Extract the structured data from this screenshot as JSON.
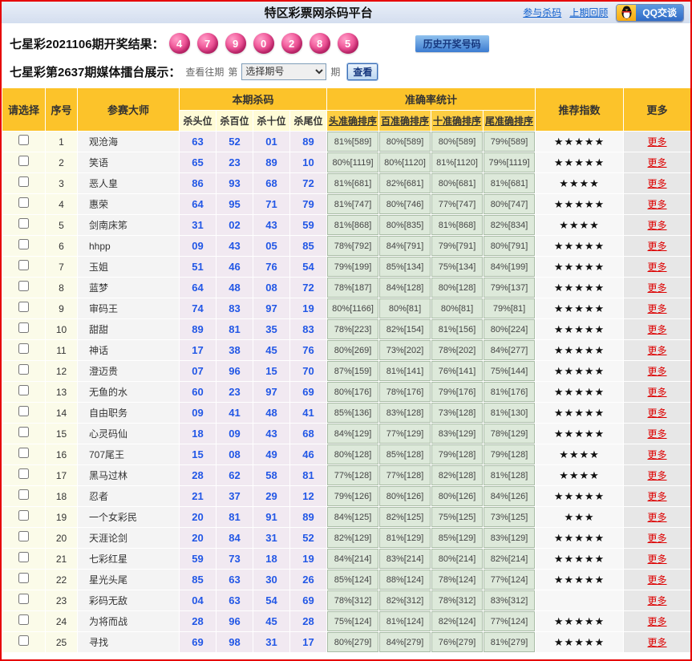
{
  "colors": {
    "page_border": "#E60000",
    "header_gold": "#FCC32A",
    "ball_pink": "#D93880",
    "kill_number_blue": "#2257E6",
    "stat_green_bg": "#DDE9DA",
    "more_red": "#DD0000",
    "link_blue": "#0B5CCC"
  },
  "topbar": {
    "title": "特区彩票网杀码平台",
    "link_join": "参与杀码",
    "link_prev": "上期回顾",
    "qq_label": "QQ交谈"
  },
  "draw": {
    "label": "七星彩2021106期开奖结果：",
    "balls": [
      "4",
      "7",
      "9",
      "0",
      "2",
      "8",
      "5"
    ],
    "history_button": "历史开奖号码"
  },
  "arena": {
    "label": "七星彩第2637期媒体擂台展示：",
    "view_past": "查看往期",
    "di": "第",
    "select_value": "选择期号",
    "qi": "期",
    "view_button": "查看"
  },
  "table": {
    "headers": {
      "select": "请选择",
      "no": "序号",
      "master": "参赛大师",
      "kills_group": "本期杀码",
      "stats_group": "准确率统计",
      "stars": "推荐指数",
      "more": "更多",
      "kill_cols": [
        "杀头位",
        "杀百位",
        "杀十位",
        "杀尾位"
      ],
      "stat_cols": [
        "头准确排序",
        "百准确排序",
        "十准确排序",
        "尾准确排序"
      ]
    },
    "rows": [
      {
        "no": "1",
        "name": "观沧海",
        "kills": [
          "63",
          "52",
          "01",
          "89"
        ],
        "stats": [
          "81%[589]",
          "80%[589]",
          "80%[589]",
          "79%[589]"
        ],
        "stars": 5
      },
      {
        "no": "2",
        "name": "笑语",
        "kills": [
          "65",
          "23",
          "89",
          "10"
        ],
        "stats": [
          "80%[1119]",
          "80%[1120]",
          "81%[1120]",
          "79%[1119]"
        ],
        "stars": 5
      },
      {
        "no": "3",
        "name": "恶人皇",
        "kills": [
          "86",
          "93",
          "68",
          "72"
        ],
        "stats": [
          "81%[681]",
          "82%[681]",
          "80%[681]",
          "81%[681]"
        ],
        "stars": 4
      },
      {
        "no": "4",
        "name": "惠荣",
        "kills": [
          "64",
          "95",
          "71",
          "79"
        ],
        "stats": [
          "81%[747]",
          "80%[746]",
          "77%[747]",
          "80%[747]"
        ],
        "stars": 5
      },
      {
        "no": "5",
        "name": "剑南床笫",
        "kills": [
          "31",
          "02",
          "43",
          "59"
        ],
        "stats": [
          "81%[868]",
          "80%[835]",
          "81%[868]",
          "82%[834]"
        ],
        "stars": 4
      },
      {
        "no": "6",
        "name": "hhpp",
        "kills": [
          "09",
          "43",
          "05",
          "85"
        ],
        "stats": [
          "78%[792]",
          "84%[791]",
          "79%[791]",
          "80%[791]"
        ],
        "stars": 5
      },
      {
        "no": "7",
        "name": "玉姐",
        "kills": [
          "51",
          "46",
          "76",
          "54"
        ],
        "stats": [
          "79%[199]",
          "85%[134]",
          "75%[134]",
          "84%[199]"
        ],
        "stars": 5
      },
      {
        "no": "8",
        "name": "蓝梦",
        "kills": [
          "64",
          "48",
          "08",
          "72"
        ],
        "stats": [
          "78%[187]",
          "84%[128]",
          "80%[128]",
          "79%[137]"
        ],
        "stars": 5
      },
      {
        "no": "9",
        "name": "审码王",
        "kills": [
          "74",
          "83",
          "97",
          "19"
        ],
        "stats": [
          "80%[1166]",
          "80%[81]",
          "80%[81]",
          "79%[81]"
        ],
        "stars": 5
      },
      {
        "no": "10",
        "name": "甜甜",
        "kills": [
          "89",
          "81",
          "35",
          "83"
        ],
        "stats": [
          "78%[223]",
          "82%[154]",
          "81%[156]",
          "80%[224]"
        ],
        "stars": 5
      },
      {
        "no": "11",
        "name": "神话",
        "kills": [
          "17",
          "38",
          "45",
          "76"
        ],
        "stats": [
          "80%[269]",
          "73%[202]",
          "78%[202]",
          "84%[277]"
        ],
        "stars": 5
      },
      {
        "no": "12",
        "name": "澄迈贵",
        "kills": [
          "07",
          "96",
          "15",
          "70"
        ],
        "stats": [
          "87%[159]",
          "81%[141]",
          "76%[141]",
          "75%[144]"
        ],
        "stars": 5
      },
      {
        "no": "13",
        "name": "无鱼的水",
        "kills": [
          "60",
          "23",
          "97",
          "69"
        ],
        "stats": [
          "80%[176]",
          "78%[176]",
          "79%[176]",
          "81%[176]"
        ],
        "stars": 5
      },
      {
        "no": "14",
        "name": "自由职务",
        "kills": [
          "09",
          "41",
          "48",
          "41"
        ],
        "stats": [
          "85%[136]",
          "83%[128]",
          "73%[128]",
          "81%[130]"
        ],
        "stars": 5
      },
      {
        "no": "15",
        "name": "心灵码仙",
        "kills": [
          "18",
          "09",
          "43",
          "68"
        ],
        "stats": [
          "84%[129]",
          "77%[129]",
          "83%[129]",
          "78%[129]"
        ],
        "stars": 5
      },
      {
        "no": "16",
        "name": "707尾王",
        "kills": [
          "15",
          "08",
          "49",
          "46"
        ],
        "stats": [
          "80%[128]",
          "85%[128]",
          "79%[128]",
          "79%[128]"
        ],
        "stars": 4
      },
      {
        "no": "17",
        "name": "黑马过林",
        "kills": [
          "28",
          "62",
          "58",
          "81"
        ],
        "stats": [
          "77%[128]",
          "77%[128]",
          "82%[128]",
          "81%[128]"
        ],
        "stars": 4
      },
      {
        "no": "18",
        "name": "忍者",
        "kills": [
          "21",
          "37",
          "29",
          "12"
        ],
        "stats": [
          "79%[126]",
          "80%[126]",
          "80%[126]",
          "84%[126]"
        ],
        "stars": 5
      },
      {
        "no": "19",
        "name": "一个女彩民",
        "kills": [
          "20",
          "81",
          "91",
          "89"
        ],
        "stats": [
          "84%[125]",
          "82%[125]",
          "75%[125]",
          "73%[125]"
        ],
        "stars": 3
      },
      {
        "no": "20",
        "name": "天涯论剑",
        "kills": [
          "20",
          "84",
          "31",
          "52"
        ],
        "stats": [
          "82%[129]",
          "81%[129]",
          "85%[129]",
          "83%[129]"
        ],
        "stars": 5
      },
      {
        "no": "21",
        "name": "七彩红星",
        "kills": [
          "59",
          "73",
          "18",
          "19"
        ],
        "stats": [
          "84%[214]",
          "83%[214]",
          "80%[214]",
          "82%[214]"
        ],
        "stars": 5
      },
      {
        "no": "22",
        "name": "星光头尾",
        "kills": [
          "85",
          "63",
          "30",
          "26"
        ],
        "stats": [
          "85%[124]",
          "88%[124]",
          "78%[124]",
          "77%[124]"
        ],
        "stars": 5
      },
      {
        "no": "23",
        "name": "彩码无敌",
        "kills": [
          "04",
          "63",
          "54",
          "69"
        ],
        "stats": [
          "78%[312]",
          "82%[312]",
          "78%[312]",
          "83%[312]"
        ],
        "stars": 0
      },
      {
        "no": "24",
        "name": "为将而战",
        "kills": [
          "28",
          "96",
          "45",
          "28"
        ],
        "stats": [
          "75%[124]",
          "81%[124]",
          "82%[124]",
          "77%[124]"
        ],
        "stars": 5
      },
      {
        "no": "25",
        "name": "寻找",
        "kills": [
          "69",
          "98",
          "31",
          "17"
        ],
        "stats": [
          "80%[279]",
          "84%[279]",
          "76%[279]",
          "81%[279]"
        ],
        "stars": 5
      }
    ]
  }
}
